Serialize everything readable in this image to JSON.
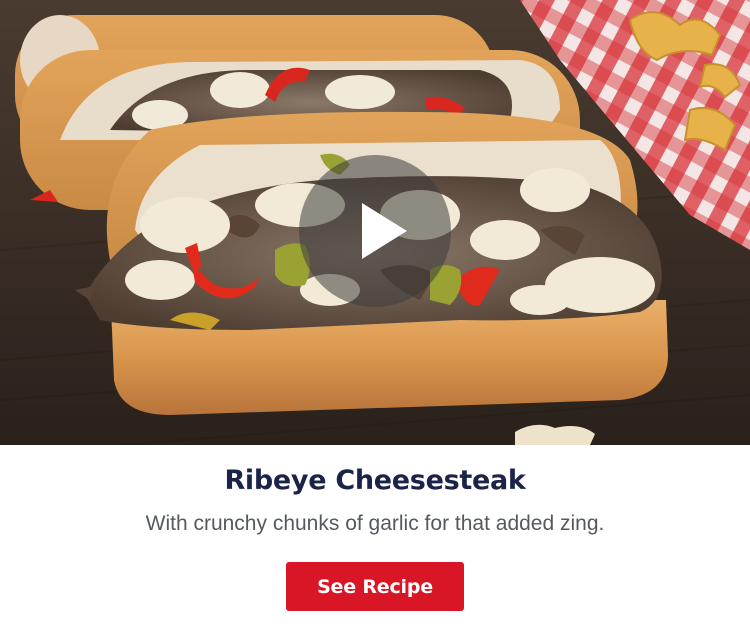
{
  "media": {
    "image_subject": "cheesesteak-sandwiches-photo",
    "play_icon": "play-icon"
  },
  "recipe": {
    "title": "Ribeye Cheesesteak",
    "description": "With crunchy chunks of garlic for that added zing.",
    "cta_label": "See Recipe"
  },
  "colors": {
    "title": "#1b2448",
    "description": "#555a60",
    "cta_background": "#d81626",
    "cta_text": "#ffffff",
    "play_overlay": "#3c3c3c"
  }
}
